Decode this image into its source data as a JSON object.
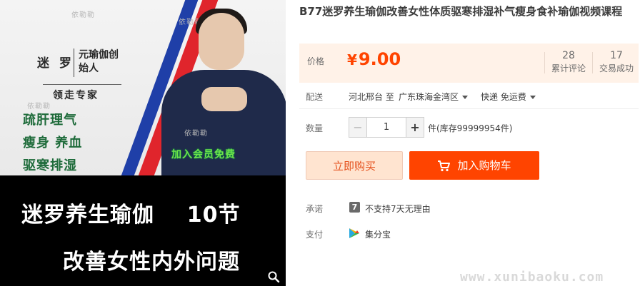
{
  "product": {
    "title": "B77迷罗养生瑜伽改善女性体质驱寒排湿补气瘦身食补瑜伽视频课程",
    "image": {
      "watermark": "依勒勒",
      "brand_name": "迷 罗",
      "brand_title": "元瑜伽创始人",
      "expert": "领走专家",
      "benefits": [
        "疏肝理气",
        "瘦身 养血",
        "驱寒排湿"
      ],
      "member_free": "加入会员免费",
      "banner_line1": "迷罗养生瑜伽    10节",
      "banner_line2": "改善女性内外问题",
      "zoom_icon": "search-icon"
    }
  },
  "price": {
    "label": "价格",
    "currency": "¥",
    "amount": "9.00",
    "color": "#ff4400"
  },
  "stats": [
    {
      "value": "28",
      "label": "累计评论"
    },
    {
      "value": "17",
      "label": "交易成功"
    }
  ],
  "shipping": {
    "label": "配送",
    "from": "河北邢台 至",
    "to": "广东珠海金湾区",
    "method": "快递 免运费"
  },
  "quantity": {
    "label": "数量",
    "value": "1",
    "minus": "−",
    "plus": "+",
    "stock": "件(库存99999954件)"
  },
  "actions": {
    "buy_now": "立即购买",
    "add_to_cart": "加入购物车"
  },
  "promise": {
    "label": "承诺",
    "icon_text": "7",
    "text": "不支持7天无理由"
  },
  "payment": {
    "label": "支付",
    "text": "集分宝"
  },
  "watermark": "www.xunibaoku.com"
}
